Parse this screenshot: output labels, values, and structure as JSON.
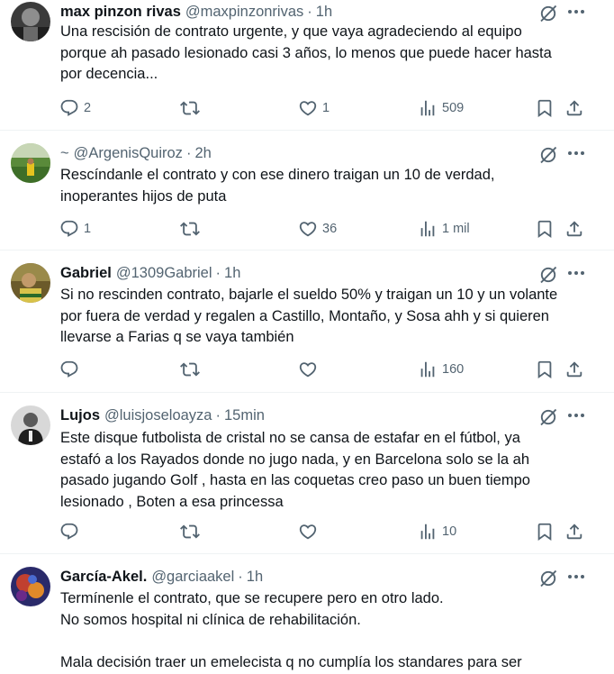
{
  "tweets": [
    {
      "name": "max pinzon rivas",
      "handle": "@maxpinzonrivas",
      "separator": "·",
      "time": "1h",
      "lines": [
        "Una rescisión de contrato urgente, y que vaya agradeciendo al equipo",
        "porque ah pasado lesionado casi 3 años, lo menos que puede hacer hasta",
        "por decencia..."
      ],
      "replies": "2",
      "reposts": "",
      "likes": "1",
      "views": "509"
    },
    {
      "prefix": "~",
      "name": "",
      "handle": "@ArgenisQuiroz",
      "separator": "·",
      "time": "2h",
      "lines": [
        "Rescíndanle el contrato y con ese dinero traigan un 10 de verdad,",
        "inoperantes hijos de puta"
      ],
      "replies": "1",
      "reposts": "",
      "likes": "36",
      "views": "1 mil"
    },
    {
      "name": "Gabriel",
      "handle": "@1309Gabriel",
      "separator": "·",
      "time": "1h",
      "lines": [
        "Si no rescinden contrato, bajarle el sueldo 50% y traigan un 10 y un volante",
        "por fuera de verdad y regalen a Castillo, Montaño, y Sosa ahh y si quieren",
        "llevarse a Farias q se vaya también"
      ],
      "replies": "",
      "reposts": "",
      "likes": "",
      "views": "160"
    },
    {
      "name": "Lujos",
      "handle": "@luisjoseloayza",
      "separator": "·",
      "time": "15min",
      "lines": [
        "Este disque futbolista de cristal no se cansa de estafar en el fútbol,  ya",
        "estafó a los Rayados donde no jugo nada,  y en Barcelona solo se la ah",
        "pasado jugando Golf , hasta en las coquetas creo paso un buen tiempo",
        "lesionado , Boten a esa princessa"
      ],
      "replies": "",
      "reposts": "",
      "likes": "",
      "views": "10"
    },
    {
      "name": "García-Akel.",
      "handle": "@garciaakel",
      "separator": "·",
      "time": "1h",
      "lines": [
        "Termínenle el contrato, que se recupere pero en otro lado.",
        "No somos hospital ni clínica de rehabilitación.",
        "",
        "Mala decisión traer un emelecista q no cumplía los standares para ser"
      ]
    }
  ],
  "colors": {
    "text": "#0f1419",
    "secondary": "#536471",
    "divider": "#eff3f4"
  },
  "icons": [
    "reply-icon",
    "repost-icon",
    "like-icon",
    "views-icon",
    "bookmark-icon",
    "share-icon",
    "grok-icon",
    "more-icon"
  ]
}
